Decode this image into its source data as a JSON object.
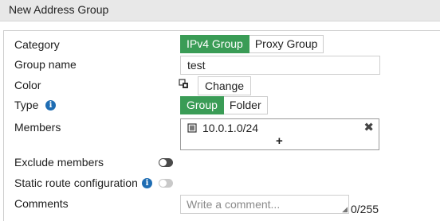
{
  "window": {
    "title": "New Address Group"
  },
  "form": {
    "category": {
      "label": "Category",
      "options": [
        "IPv4 Group",
        "Proxy Group"
      ],
      "selected": "IPv4 Group"
    },
    "group_name": {
      "label": "Group name",
      "value": "test"
    },
    "color": {
      "label": "Color",
      "button": "Change"
    },
    "type": {
      "label": "Type",
      "options": [
        "Group",
        "Folder"
      ],
      "selected": "Group"
    },
    "members": {
      "label": "Members",
      "items": [
        {
          "name": "10.0.1.0/24"
        }
      ],
      "add_symbol": "+",
      "remove_symbol": "✖"
    },
    "exclude_members": {
      "label": "Exclude members",
      "enabled": false
    },
    "static_route": {
      "label": "Static route configuration",
      "enabled": false
    },
    "comments": {
      "label": "Comments",
      "placeholder": "Write a comment...",
      "counter": "0/255"
    }
  },
  "colors": {
    "accent": "#3a9c56",
    "info": "#1f6db3"
  }
}
